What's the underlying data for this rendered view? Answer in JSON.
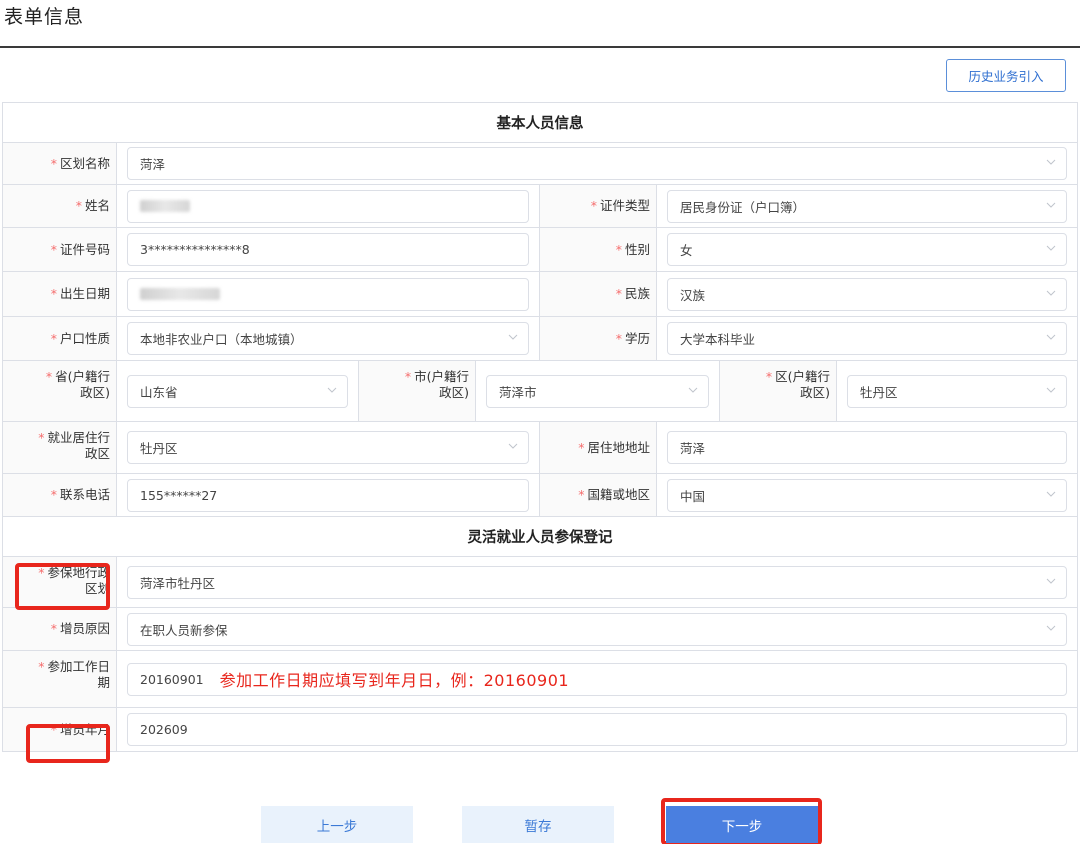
{
  "page": {
    "title": "表单信息",
    "history_button": "历史业务引入"
  },
  "sections": {
    "basic": "基本人员信息",
    "insure": "灵活就业人员参保登记"
  },
  "required_mark": "*",
  "fields": {
    "region_name": {
      "label": "区划名称",
      "value": "菏泽"
    },
    "name": {
      "label": "姓名",
      "value": ""
    },
    "id_type": {
      "label": "证件类型",
      "value": "居民身份证（户口簿）"
    },
    "id_number": {
      "label": "证件号码",
      "value": "3***************8"
    },
    "gender": {
      "label": "性别",
      "value": "女"
    },
    "birth_date": {
      "label": "出生日期",
      "value": ""
    },
    "ethnicity": {
      "label": "民族",
      "value": "汉族"
    },
    "hukou_type": {
      "label": "户口性质",
      "value": "本地非农业户口（本地城镇）"
    },
    "education": {
      "label": "学历",
      "value": "大学本科毕业"
    },
    "province": {
      "label_1": "省(户籍行",
      "label_2": "政区)",
      "value": "山东省"
    },
    "city": {
      "label_1": "市(户籍行",
      "label_2": "政区)",
      "value": "菏泽市"
    },
    "district": {
      "label_1": "区(户籍行",
      "label_2": "政区)",
      "value": "牡丹区"
    },
    "employ_region": {
      "label_1": "就业居住行",
      "label_2": "政区",
      "value": "牡丹区"
    },
    "address": {
      "label": "居住地地址",
      "value": "菏泽"
    },
    "phone": {
      "label": "联系电话",
      "value": "155******27"
    },
    "nationality": {
      "label": "国籍或地区",
      "value": "中国"
    },
    "insure_region": {
      "label_1": "参保地行政",
      "label_2": "区划",
      "value": "菏泽市牡丹区"
    },
    "add_reason": {
      "label": "增员原因",
      "value": "在职人员新参保"
    },
    "work_date": {
      "label_1": "参加工作日",
      "label_2": "期",
      "value": "20160901"
    },
    "add_month": {
      "label": "增员年月",
      "value": "202609"
    }
  },
  "annotation": {
    "hint": "参加工作日期应填写到年月日，例：20160901",
    "color": "#e8261c"
  },
  "buttons": {
    "prev": "上一步",
    "save": "暂存",
    "next": "下一步"
  },
  "icons": {
    "dropdown": "chevron-down-icon"
  }
}
